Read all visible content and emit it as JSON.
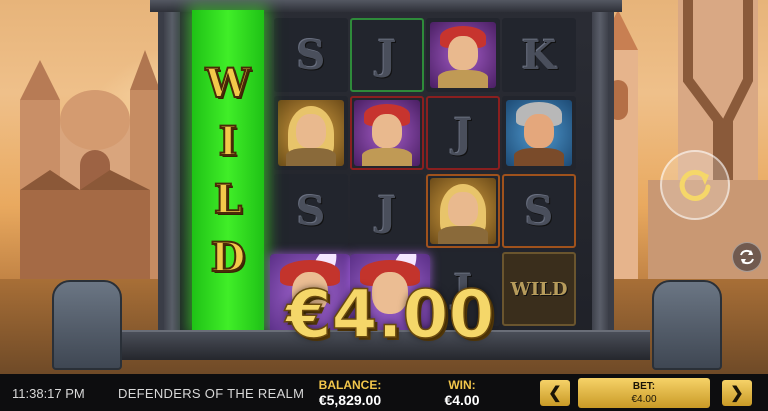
{
  "game": {
    "title": "DEFENDERS OF THE REALM",
    "clock": "11:38:17 PM"
  },
  "reels": {
    "wild_column_letters": [
      "W",
      "I",
      "L",
      "D"
    ],
    "symbols": [
      [
        {
          "type": "letter",
          "value": "S"
        },
        {
          "type": "letter",
          "value": "J"
        },
        {
          "type": "portrait",
          "value": "red-hat-warrior"
        },
        {
          "type": "letter",
          "value": "K"
        }
      ],
      [
        {
          "type": "portrait",
          "value": "blonde-heroine"
        },
        {
          "type": "portrait",
          "value": "red-hat-warrior"
        },
        {
          "type": "letter",
          "value": "J"
        },
        {
          "type": "portrait",
          "value": "viking-warrior"
        }
      ],
      [
        {
          "type": "letter",
          "value": "S"
        },
        {
          "type": "letter",
          "value": "J"
        },
        {
          "type": "portrait",
          "value": "blonde-heroine"
        },
        {
          "type": "letter",
          "value": "S"
        }
      ],
      [
        {
          "type": "portrait",
          "value": "red-hat-warrior"
        },
        {
          "type": "portrait",
          "value": "red-hat-warrior"
        },
        {
          "type": "letter",
          "value": "J"
        },
        {
          "type": "wild",
          "value": "WILD"
        }
      ]
    ],
    "wild_tile_label": "WILD",
    "highlight_colors": {
      "green": "#2e8b3a",
      "red": "#8a1f1f",
      "orange": "#a0521c",
      "wild": "#3fe52a"
    }
  },
  "win_overlay": {
    "amount": "€4.00"
  },
  "controls": {
    "spin_icon": "rotate-arrow-icon",
    "autoplay_icon": "autoplay-cycle-icon"
  },
  "bottom_bar": {
    "balance_label": "BALANCE:",
    "balance_value": "€5,829.00",
    "win_label": "WIN:",
    "win_value": "€4.00",
    "bet_label": "BET:",
    "bet_value": "€4.00",
    "bet_decrease": "❮",
    "bet_increase": "❯"
  }
}
